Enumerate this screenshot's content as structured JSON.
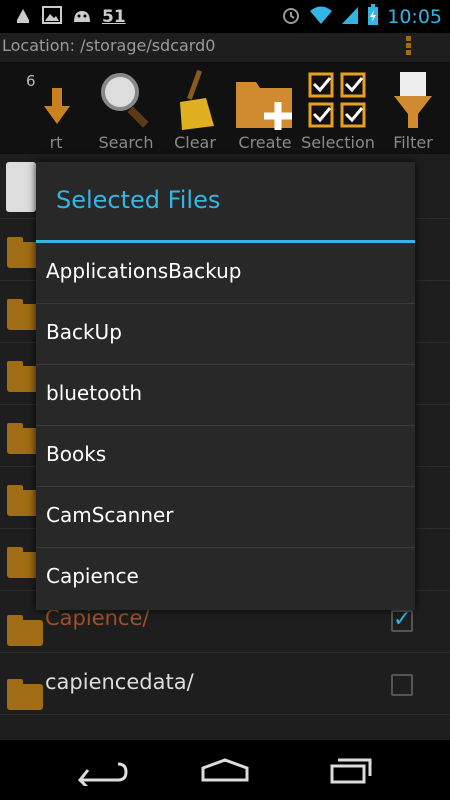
{
  "status_bar": {
    "notification_count": "51",
    "time": "10:05",
    "icons": [
      "android-debug-icon",
      "image-icon",
      "android-icon",
      "alarm-icon",
      "wifi-icon",
      "signal-icon",
      "battery-charging-icon"
    ]
  },
  "location": "Location: /storage/sdcard0",
  "file_count": "6",
  "toolbar": {
    "sort_label": "rt",
    "search_label": "Search",
    "clear_label": "Clear",
    "create_label": "Create",
    "selection_label": "Selection",
    "filter_label": "Filter"
  },
  "background_list": {
    "items": [
      {
        "name": "Capience/",
        "checked": true
      },
      {
        "name": "capiencedata/",
        "checked": false
      }
    ]
  },
  "dialog": {
    "title": "Selected Files",
    "items": [
      "ApplicationsBackup",
      "BackUp",
      "bluetooth",
      "Books",
      "CamScanner",
      "Capience"
    ]
  },
  "nav_bar": {
    "buttons": [
      "back-icon",
      "home-icon",
      "recent-apps-icon"
    ]
  },
  "colors": {
    "accent": "#33b5e5",
    "folder": "#a06c14",
    "background": "#1e1e1e",
    "dialog": "#282828"
  }
}
